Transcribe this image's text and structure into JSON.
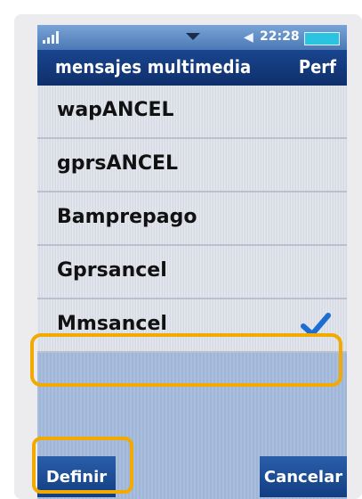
{
  "status": {
    "time": "22:28"
  },
  "header": {
    "title": "mensajes multimedia",
    "profile": "Perf"
  },
  "list": [
    {
      "label": "wapANCEL",
      "selected": false
    },
    {
      "label": "gprsANCEL",
      "selected": false
    },
    {
      "label": "Bamprepago",
      "selected": false
    },
    {
      "label": "Gprsancel",
      "selected": false
    },
    {
      "label": "Mmsancel",
      "selected": true
    }
  ],
  "softkeys": {
    "left": "Definir",
    "right": "Cancelar"
  },
  "colors": {
    "highlight": "#f2a900",
    "title_bg": "#0f2f6b",
    "check": "#1c6fd0"
  }
}
